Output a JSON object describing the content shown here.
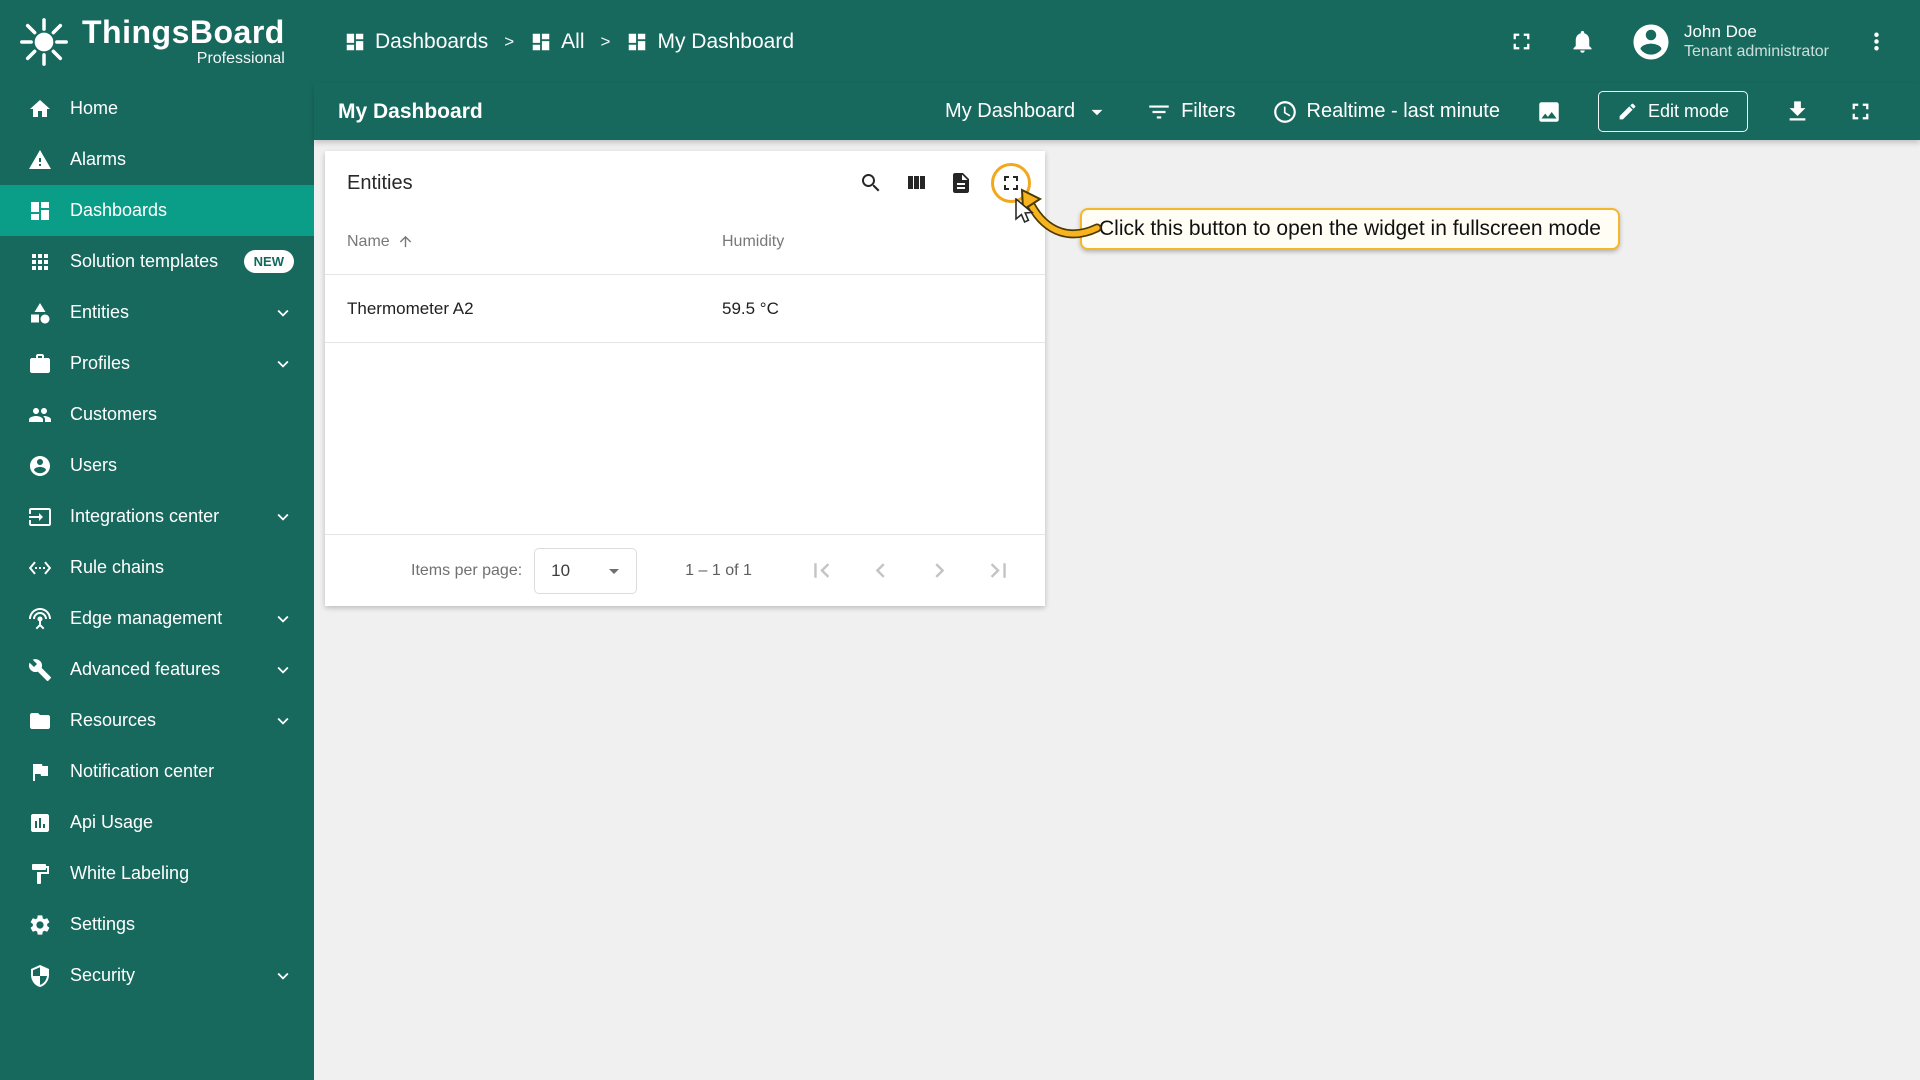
{
  "brand": {
    "name": "ThingsBoard",
    "edition": "Professional"
  },
  "header": {
    "separator": ">",
    "breadcrumbs": [
      {
        "label": "Dashboards"
      },
      {
        "label": "All"
      },
      {
        "label": "My Dashboard"
      }
    ],
    "user": {
      "name": "John Doe",
      "role": "Tenant administrator"
    }
  },
  "toolbar": {
    "title": "My Dashboard",
    "dashboard_selector": "My Dashboard",
    "filters": "Filters",
    "timewindow": "Realtime - last minute",
    "edit_mode": "Edit mode"
  },
  "sidebar": {
    "items": [
      {
        "label": "Home"
      },
      {
        "label": "Alarms"
      },
      {
        "label": "Dashboards",
        "active": true
      },
      {
        "label": "Solution templates",
        "badge": "NEW"
      },
      {
        "label": "Entities",
        "expandable": true
      },
      {
        "label": "Profiles",
        "expandable": true
      },
      {
        "label": "Customers"
      },
      {
        "label": "Users"
      },
      {
        "label": "Integrations center",
        "expandable": true
      },
      {
        "label": "Rule chains"
      },
      {
        "label": "Edge management",
        "expandable": true
      },
      {
        "label": "Advanced features",
        "expandable": true
      },
      {
        "label": "Resources",
        "expandable": true
      },
      {
        "label": "Notification center"
      },
      {
        "label": "Api Usage"
      },
      {
        "label": "White Labeling"
      },
      {
        "label": "Settings"
      },
      {
        "label": "Security",
        "expandable": true
      }
    ]
  },
  "widget": {
    "title": "Entities",
    "table": {
      "columns": [
        "Name",
        "Humidity"
      ],
      "rows": [
        {
          "name": "Thermometer A2",
          "humidity": "59.5 °C"
        }
      ]
    },
    "paginator": {
      "items_per_page_label": "Items per page:",
      "page_size": "10",
      "range": "1 – 1 of 1"
    }
  },
  "annotation": {
    "tooltip": "Click this button to open the widget in fullscreen mode"
  },
  "colors": {
    "primary": "#17695e",
    "active_item": "#0a9d87",
    "highlight": "#f2a81d"
  }
}
